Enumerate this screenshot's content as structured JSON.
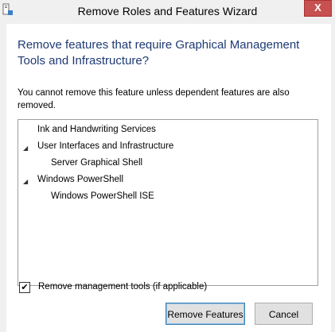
{
  "window": {
    "title": "Remove Roles and Features Wizard",
    "close_glyph": "X"
  },
  "dialog": {
    "heading": "Remove features that require Graphical Management Tools and Infrastructure?",
    "description": "You cannot remove this feature unless dependent features are also removed."
  },
  "features": [
    {
      "label": "Ink and Handwriting Services",
      "level": 0,
      "expander": ""
    },
    {
      "label": "User Interfaces and Infrastructure",
      "level": 0,
      "expander": "◢"
    },
    {
      "label": "Server Graphical Shell",
      "level": 1,
      "expander": ""
    },
    {
      "label": "Windows PowerShell",
      "level": 0,
      "expander": "◢"
    },
    {
      "label": "Windows PowerShell ISE",
      "level": 1,
      "expander": ""
    }
  ],
  "options": {
    "remove_tools_label": "Remove management tools (if applicable)",
    "remove_tools_checked": true,
    "check_glyph": "✔"
  },
  "buttons": {
    "remove_label": "Remove Features",
    "cancel_label": "Cancel"
  },
  "icons": {
    "app": "server-manager-icon",
    "close": "close-icon",
    "expand": "expanded-arrow-icon"
  }
}
